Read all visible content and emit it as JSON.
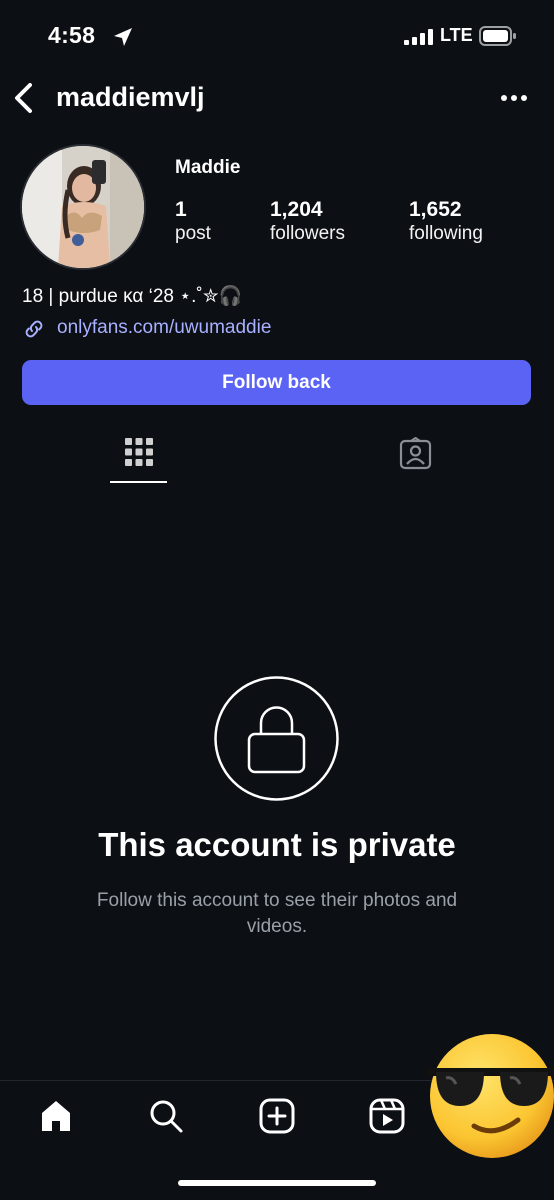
{
  "status_bar": {
    "time": "4:58",
    "network": "LTE",
    "icons": [
      "location-arrow-icon",
      "signal-bars-icon",
      "battery-icon"
    ]
  },
  "header": {
    "username": "maddiemvlj",
    "icons": [
      "back-chevron-icon",
      "more-options-icon"
    ]
  },
  "profile": {
    "display_name": "Maddie",
    "stats": [
      {
        "value": "1",
        "label": "post"
      },
      {
        "value": "1,204",
        "label": "followers"
      },
      {
        "value": "1,652",
        "label": "following"
      }
    ],
    "bio": "18 | purdue κα ‘28 ⋆.˚✮🎧",
    "link": "onlyfans.com/uwumaddie",
    "follow_button": "Follow back"
  },
  "tabs": [
    {
      "icon": "grid-icon",
      "active": true
    },
    {
      "icon": "tagged-person-icon",
      "active": false
    }
  ],
  "private_notice": {
    "title": "This account is private",
    "subtitle": "Follow this account to see their photos and videos.",
    "icon": "lock-icon"
  },
  "bottom_nav": [
    "home-icon",
    "search-icon",
    "create-icon",
    "reels-icon"
  ],
  "overlay_sticker": "sunglasses-emoji",
  "colors": {
    "background": "#0c0f14",
    "accent": "#5b63f5",
    "link": "#a8b0ff",
    "muted_text": "#9aa0a8"
  }
}
